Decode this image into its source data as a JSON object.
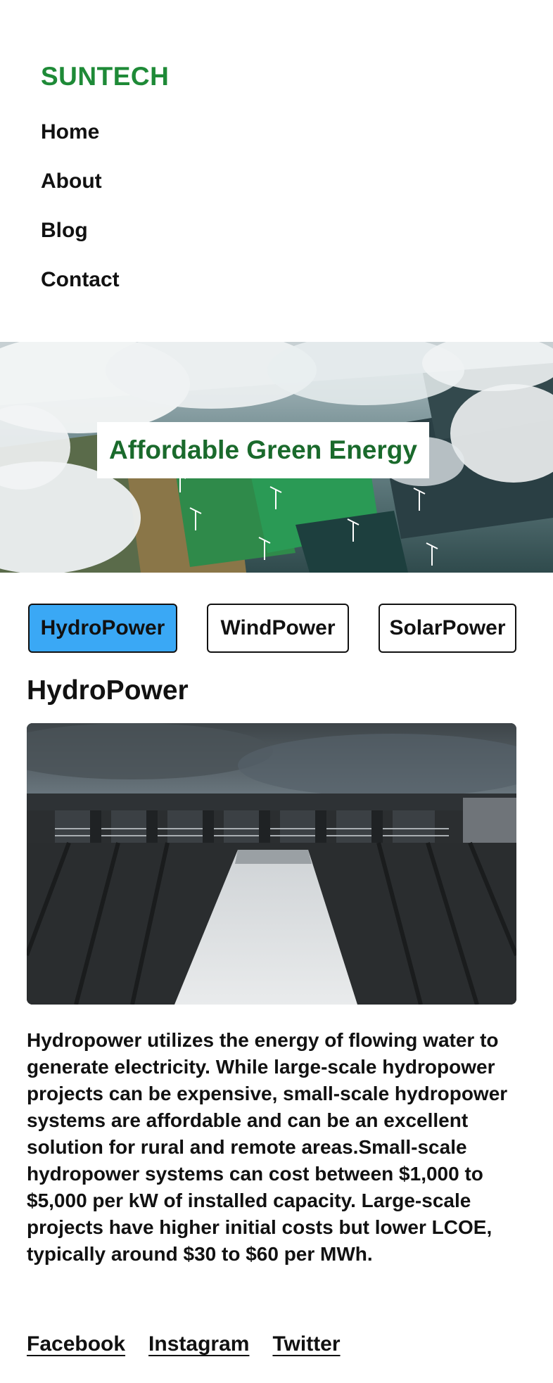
{
  "brand": "SUNTECH",
  "nav": {
    "items": [
      {
        "label": "Home"
      },
      {
        "label": "About"
      },
      {
        "label": "Blog"
      },
      {
        "label": "Contact"
      }
    ]
  },
  "hero": {
    "title": "Affordable Green Energy",
    "image": "aerial-wind-farm-clouds"
  },
  "tabs": {
    "items": [
      {
        "label": "HydroPower",
        "active": true
      },
      {
        "label": "WindPower",
        "active": false
      },
      {
        "label": "SolarPower",
        "active": false
      }
    ],
    "active_color": "#3aa8f5"
  },
  "content": {
    "title": "HydroPower",
    "image": "hydroelectric-dam",
    "description": "Hydropower utilizes the energy of flowing water to generate electricity. While large-scale hydropower projects can be expensive, small-scale hydropower systems are affordable and can be an excellent solution for rural and remote areas.Small-scale hydropower systems can cost between $1,000 to $5,000 per kW of installed capacity. Large-scale projects have higher initial costs but lower LCOE, typically around $30 to $60 per MWh."
  },
  "footer": {
    "links": [
      {
        "label": "Facebook"
      },
      {
        "label": "Instagram"
      },
      {
        "label": "Twitter"
      }
    ]
  },
  "colors": {
    "brand": "#1e8a37",
    "hero_title": "#1a6a2c"
  }
}
